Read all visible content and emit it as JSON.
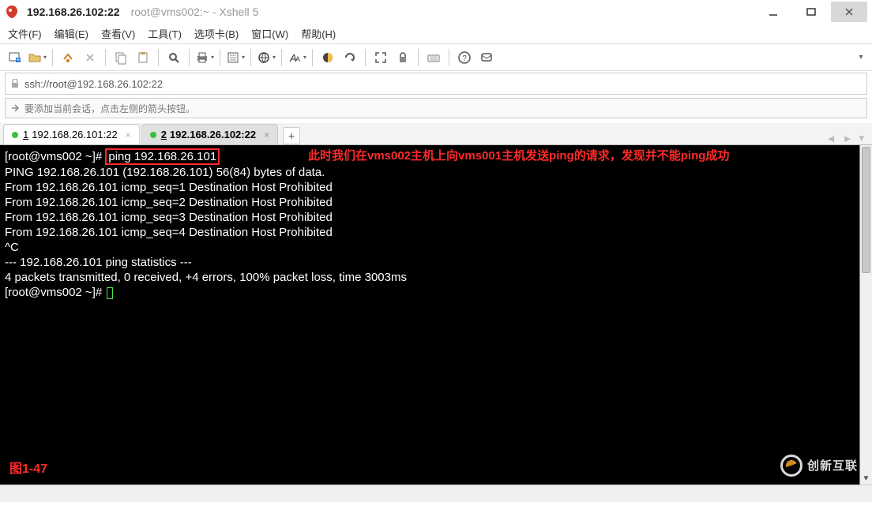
{
  "window": {
    "ip_title": "192.168.26.102:22",
    "sub_title": "root@vms002:~ - Xshell 5"
  },
  "menu": {
    "file": "文件(F)",
    "edit": "编辑(E)",
    "view": "查看(V)",
    "tools": "工具(T)",
    "tabs": "选项卡(B)",
    "window": "窗口(W)",
    "help": "帮助(H)"
  },
  "toolbar_icons": {
    "new_session": "new-session-icon",
    "open": "open-folder-icon",
    "reconnect": "reconnect-icon",
    "disconnect": "disconnect-icon",
    "copy": "copy-icon",
    "paste": "paste-icon",
    "find": "find-icon",
    "print": "print-icon",
    "properties": "properties-icon",
    "web": "web-icon",
    "font": "font-icon",
    "color": "color-scheme-icon",
    "refresh": "refresh-icon",
    "fullscreen": "fullscreen-icon",
    "lock": "lock-icon",
    "keymap": "keymap-icon",
    "help": "help-icon",
    "compose": "compose-icon"
  },
  "address": {
    "url": "ssh://root@192.168.26.102:22"
  },
  "hint": {
    "text": "要添加当前会话，点击左侧的箭头按钮。"
  },
  "tabs": {
    "t1_num": "1",
    "t1_label": "192.168.26.101:22",
    "t2_num": "2",
    "t2_label": "192.168.26.102:22",
    "add": "+"
  },
  "terminal": {
    "prompt1_a": "[root@vms002 ~]# ",
    "cmd": "ping 192.168.26.101",
    "annotation": "此时我们在vms002主机上向vms001主机发送ping的请求，发现并不能ping成功",
    "l2": "PING 192.168.26.101 (192.168.26.101) 56(84) bytes of data.",
    "l3": "From 192.168.26.101 icmp_seq=1 Destination Host Prohibited",
    "l4": "From 192.168.26.101 icmp_seq=2 Destination Host Prohibited",
    "l5": "From 192.168.26.101 icmp_seq=3 Destination Host Prohibited",
    "l6": "From 192.168.26.101 icmp_seq=4 Destination Host Prohibited",
    "l7": "^C",
    "l8": "--- 192.168.26.101 ping statistics ---",
    "l9": "4 packets transmitted, 0 received, +4 errors, 100% packet loss, time 3003ms",
    "blank": "",
    "prompt2": "[root@vms002 ~]# ",
    "figure": "图1-47"
  },
  "watermark": {
    "text": "创新互联"
  }
}
